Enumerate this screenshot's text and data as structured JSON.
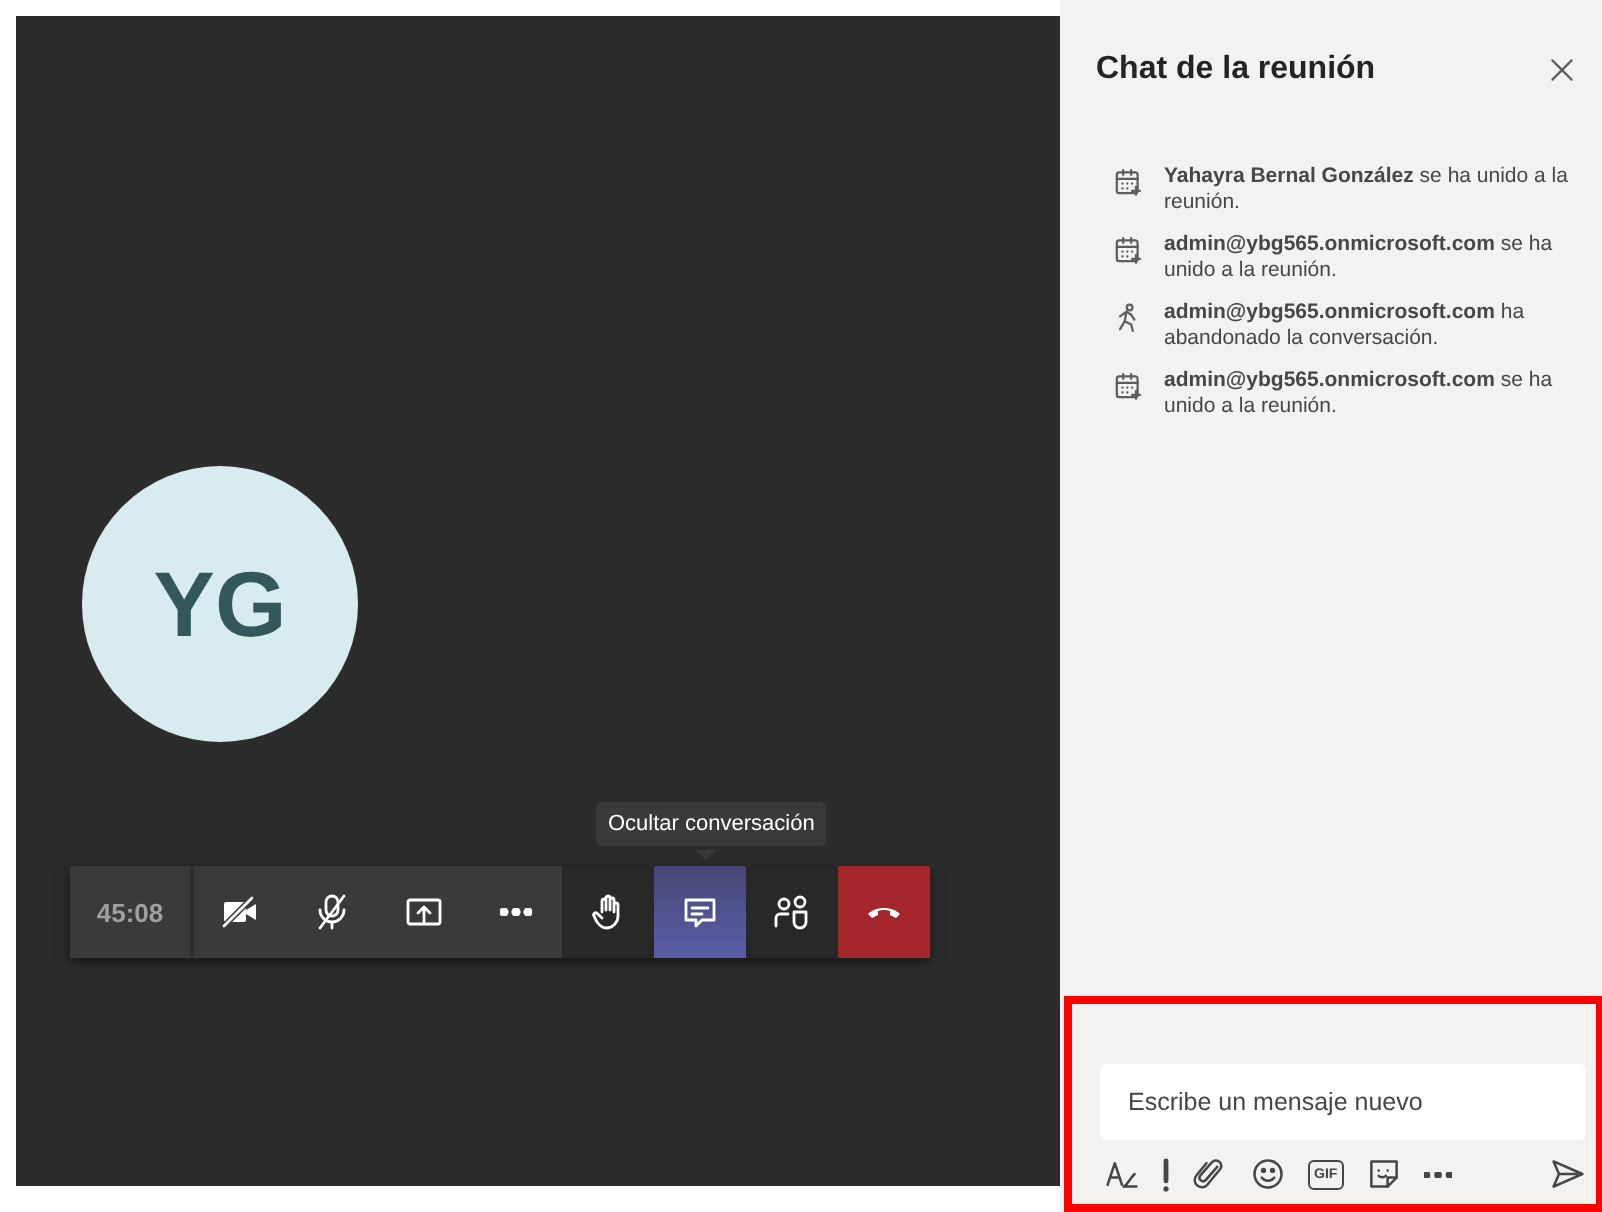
{
  "stage": {
    "avatar_initials": "YG",
    "tooltip": "Ocultar conversación"
  },
  "controls": [
    {
      "kind": "timer",
      "label": "45:08",
      "selected": false
    },
    {
      "kind": "camera-off",
      "selected": false
    },
    {
      "kind": "mic-off",
      "selected": false
    },
    {
      "kind": "share",
      "selected": false
    },
    {
      "kind": "more",
      "selected": false
    },
    {
      "kind": "hand",
      "selected": false
    },
    {
      "kind": "chat",
      "selected": true
    },
    {
      "kind": "people",
      "selected": false
    },
    {
      "kind": "hangup",
      "selected": false
    }
  ],
  "chat": {
    "title": "Chat de la reunión",
    "messages": [
      {
        "kind": "joined",
        "text": "**Yahayra Bernal González** se ha unido a la reunión."
      },
      {
        "kind": "joined",
        "text": "**admin@ybg565.onmicrosoft.com** se ha unido a la reunión."
      },
      {
        "kind": "left",
        "text": "**admin@ybg565.onmicrosoft.com** ha abandonado la conversación."
      },
      {
        "kind": "joined",
        "text": "**admin@ybg565.onmicrosoft.com** se ha unido a la reunión."
      }
    ],
    "compose": {
      "placeholder": "Escribe un mensaje nuevo"
    },
    "tools": [
      {
        "kind": "format"
      },
      {
        "kind": "important"
      },
      {
        "kind": "attach"
      },
      {
        "kind": "emoji"
      },
      {
        "kind": "gif",
        "label": "GIF"
      },
      {
        "kind": "sticker"
      },
      {
        "kind": "more"
      },
      {
        "kind": "send"
      }
    ]
  },
  "annotation": {
    "highlight": true
  }
}
